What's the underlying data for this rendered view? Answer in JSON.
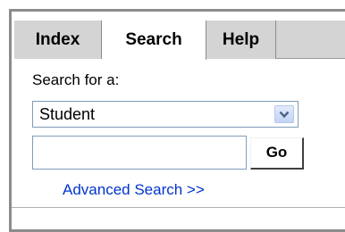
{
  "tabs": [
    {
      "label": "Index",
      "active": false
    },
    {
      "label": "Search",
      "active": true
    },
    {
      "label": "Help",
      "active": false
    }
  ],
  "search": {
    "label": "Search for a:",
    "selected_option": "Student",
    "query_value": "",
    "go_label": "Go",
    "advanced_link": "Advanced Search >>"
  },
  "colors": {
    "tab_inactive": "#d4d4d4",
    "link": "#0033cc",
    "frame": "#8c8c8c"
  }
}
